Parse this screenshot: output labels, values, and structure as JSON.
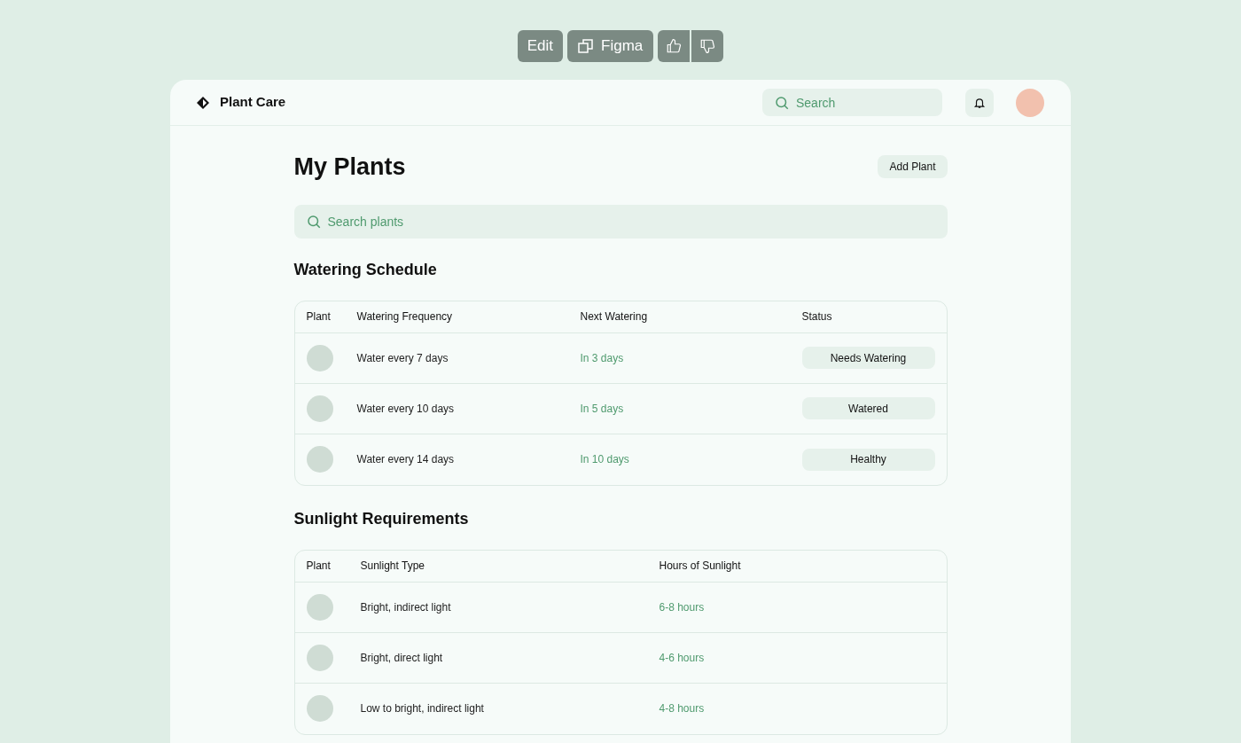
{
  "toolbar": {
    "edit": "Edit",
    "figma": "Figma"
  },
  "header": {
    "brand": "Plant Care",
    "search": {
      "placeholder": "Search"
    }
  },
  "page": {
    "title": "My Plants",
    "add_button": "Add Plant",
    "search": {
      "placeholder": "Search plants"
    }
  },
  "watering": {
    "title": "Watering Schedule",
    "columns": [
      "Plant",
      "Watering Frequency",
      "Next Watering",
      "Status"
    ],
    "rows": [
      {
        "frequency": "Water every 7 days",
        "next": "In 3 days",
        "status": "Needs Watering"
      },
      {
        "frequency": "Water every 10 days",
        "next": "In 5 days",
        "status": "Watered"
      },
      {
        "frequency": "Water every 14 days",
        "next": "In 10 days",
        "status": "Healthy"
      }
    ]
  },
  "sunlight": {
    "title": "Sunlight Requirements",
    "columns": [
      "Plant",
      "Sunlight Type",
      "Hours of Sunlight"
    ],
    "rows": [
      {
        "type": "Bright, indirect light",
        "hours": "6-8 hours"
      },
      {
        "type": "Bright, direct light",
        "hours": "4-6 hours"
      },
      {
        "type": "Low to bright, indirect light",
        "hours": "4-8 hours"
      }
    ]
  }
}
